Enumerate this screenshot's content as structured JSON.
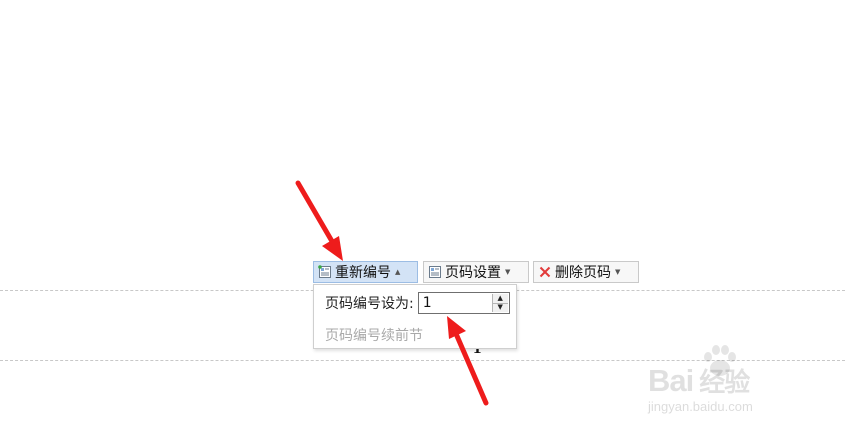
{
  "toolbar": {
    "renumber_label": "重新编号",
    "page_settings_label": "页码设置",
    "delete_label": "删除页码"
  },
  "renumber_popup": {
    "set_label": "页码编号设为:",
    "value": "1",
    "continue_label": "页码编号续前节"
  },
  "page": {
    "page_number": "1"
  },
  "watermark": {
    "brand": "Bai",
    "brand_suffix": "经验",
    "url": "jingyan.baidu.com"
  },
  "colors": {
    "annotation_arrow": "#ee1c1c",
    "active_button_bg": "#d3e3f6",
    "delete_icon": "#e23b3b"
  },
  "icons": [
    "page-number-icon",
    "page-number-icon",
    "delete-x-icon",
    "caret-down-icon",
    "spin-up-icon",
    "spin-down-icon"
  ]
}
